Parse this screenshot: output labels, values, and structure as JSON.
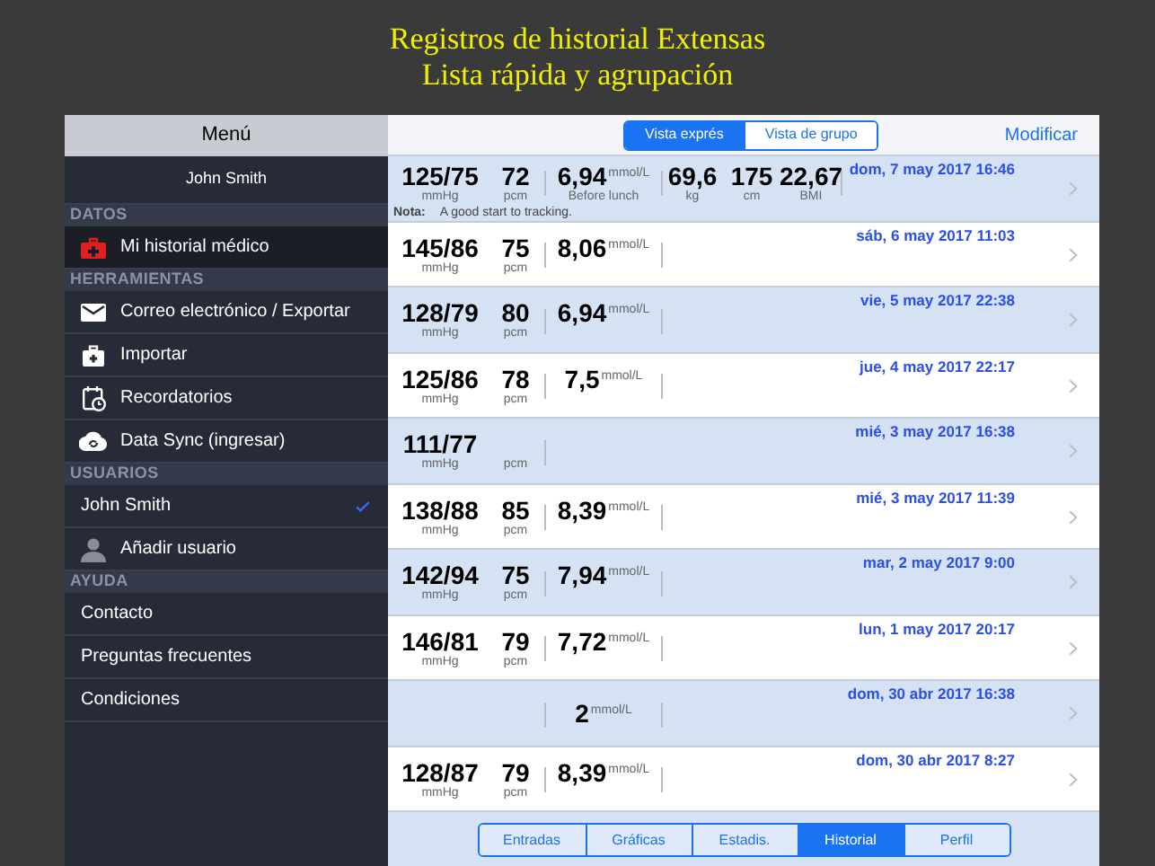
{
  "caption": [
    "Registros de historial Extensas",
    "Lista rápida y agrupación"
  ],
  "sidebar": {
    "title": "Menú",
    "user": "John Smith",
    "sections": [
      {
        "title": "DATOS",
        "items": [
          {
            "label": "Mi historial médico",
            "kind": "medkit",
            "selected": true
          }
        ]
      },
      {
        "title": "HERRAMIENTAS",
        "items": [
          {
            "label": "Correo electrónico / Exportar",
            "kind": "envelope",
            "selected": false
          },
          {
            "label": "Importar",
            "kind": "briefcase",
            "selected": false
          },
          {
            "label": "Recordatorios",
            "kind": "calendar",
            "selected": false
          },
          {
            "label": "Data Sync (ingresar)",
            "kind": "cloud",
            "selected": false
          }
        ]
      },
      {
        "title": "USUARIOS",
        "items": [
          {
            "label": "John Smith",
            "kind": "plain",
            "selected": false,
            "checked": true
          },
          {
            "label": "Añadir usuario",
            "kind": "person",
            "selected": false,
            "checked": false
          }
        ]
      },
      {
        "title": "AYUDA",
        "items": [
          {
            "label": "Contacto",
            "kind": "plain",
            "selected": false
          },
          {
            "label": "Preguntas frecuentes",
            "kind": "plain",
            "selected": false
          },
          {
            "label": "Condiciones",
            "kind": "plain",
            "selected": false
          }
        ]
      }
    ]
  },
  "toolbar": {
    "views": [
      {
        "label": "Vista exprés",
        "selected": true
      },
      {
        "label": "Vista de grupo",
        "selected": false
      }
    ],
    "action": "Modificar"
  },
  "rows": [
    {
      "date": "dom, 7 may 2017 16:46",
      "bp": {
        "value": "125/75",
        "unit": "mmHg"
      },
      "pulse": {
        "value": "72",
        "unit": "pcm"
      },
      "glucose": {
        "value": "6,94",
        "unit": "mmol/L",
        "note": "Before lunch"
      },
      "extras": [
        {
          "value": "69,6",
          "unit": "kg"
        },
        {
          "value": "175",
          "unit": "cm"
        },
        {
          "value": "22,67",
          "unit": "BMI"
        }
      ],
      "note": {
        "label": "Nota:",
        "text": "A good start to tracking."
      }
    },
    {
      "date": "sáb, 6 may 2017 11:03",
      "bp": {
        "value": "145/86",
        "unit": "mmHg"
      },
      "pulse": {
        "value": "75",
        "unit": "pcm"
      },
      "glucose": {
        "value": "8,06",
        "unit": "mmol/L"
      }
    },
    {
      "date": "vie, 5 may 2017 22:38",
      "bp": {
        "value": "128/79",
        "unit": "mmHg"
      },
      "pulse": {
        "value": "80",
        "unit": "pcm"
      },
      "glucose": {
        "value": "6,94",
        "unit": "mmol/L"
      }
    },
    {
      "date": "jue, 4 may 2017 22:17",
      "bp": {
        "value": "125/86",
        "unit": "mmHg"
      },
      "pulse": {
        "value": "78",
        "unit": "pcm"
      },
      "glucose": {
        "value": "7,5",
        "unit": "mmol/L"
      }
    },
    {
      "date": "mié, 3 may 2017 16:38",
      "bp": {
        "value": "111/77",
        "unit": "mmHg"
      },
      "pulse": {
        "unit": "pcm"
      }
    },
    {
      "date": "mié, 3 may 2017 11:39",
      "bp": {
        "value": "138/88",
        "unit": "mmHg"
      },
      "pulse": {
        "value": "85",
        "unit": "pcm"
      },
      "glucose": {
        "value": "8,39",
        "unit": "mmol/L"
      }
    },
    {
      "date": "mar, 2 may 2017 9:00",
      "bp": {
        "value": "142/94",
        "unit": "mmHg"
      },
      "pulse": {
        "value": "75",
        "unit": "pcm"
      },
      "glucose": {
        "value": "7,94",
        "unit": "mmol/L"
      }
    },
    {
      "date": "lun, 1 may 2017 20:17",
      "bp": {
        "value": "146/81",
        "unit": "mmHg"
      },
      "pulse": {
        "value": "79",
        "unit": "pcm"
      },
      "glucose": {
        "value": "7,72",
        "unit": "mmol/L"
      }
    },
    {
      "date": "dom, 30 abr 2017 16:38",
      "glucose": {
        "value": "2",
        "unit": "mmol/L"
      }
    },
    {
      "date": "dom, 30 abr 2017 8:27",
      "bp": {
        "value": "128/87",
        "unit": "mmHg"
      },
      "pulse": {
        "value": "79",
        "unit": "pcm"
      },
      "glucose": {
        "value": "8,39",
        "unit": "mmol/L"
      }
    }
  ],
  "tabs": [
    {
      "label": "Entradas",
      "selected": false
    },
    {
      "label": "Gráficas",
      "selected": false
    },
    {
      "label": "Estadis.",
      "selected": false
    },
    {
      "label": "Historial",
      "selected": true
    },
    {
      "label": "Perfil",
      "selected": false
    }
  ]
}
